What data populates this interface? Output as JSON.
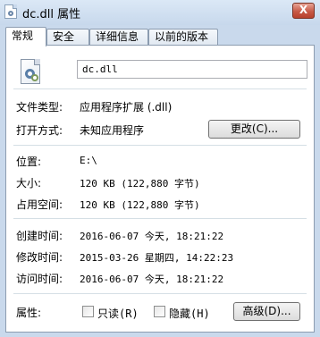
{
  "window": {
    "title": "dc.dll 属性",
    "close_label": "X"
  },
  "tabs": [
    {
      "label": "常规",
      "active": true
    },
    {
      "label": "安全",
      "active": false
    },
    {
      "label": "详细信息",
      "active": false
    },
    {
      "label": "以前的版本",
      "active": false
    }
  ],
  "general": {
    "file_name": "dc.dll",
    "file_type_label": "文件类型:",
    "file_type_value": "应用程序扩展 (.dll)",
    "open_with_label": "打开方式:",
    "open_with_value": "未知应用程序",
    "change_button": "更改(C)...",
    "location_label": "位置:",
    "location_value": "E:\\",
    "size_label": "大小:",
    "size_value": "120 KB (122,880 字节)",
    "size_on_disk_label": "占用空间:",
    "size_on_disk_value": "120 KB (122,880 字节)",
    "created_label": "创建时间:",
    "created_value": "2016-06-07 今天, 18:21:22",
    "modified_label": "修改时间:",
    "modified_value": "2015-03-26 星期四, 14:22:23",
    "accessed_label": "访问时间:",
    "accessed_value": "2016-06-07 今天, 18:21:22",
    "attributes_label": "属性:",
    "readonly_label": "只读(R)",
    "readonly_checked": false,
    "hidden_label": "隐藏(H)",
    "hidden_checked": false,
    "advanced_button": "高级(D)..."
  },
  "icons": {
    "title_icon": "dll-file-icon",
    "file_icon": "dll-file-gear-icon"
  }
}
